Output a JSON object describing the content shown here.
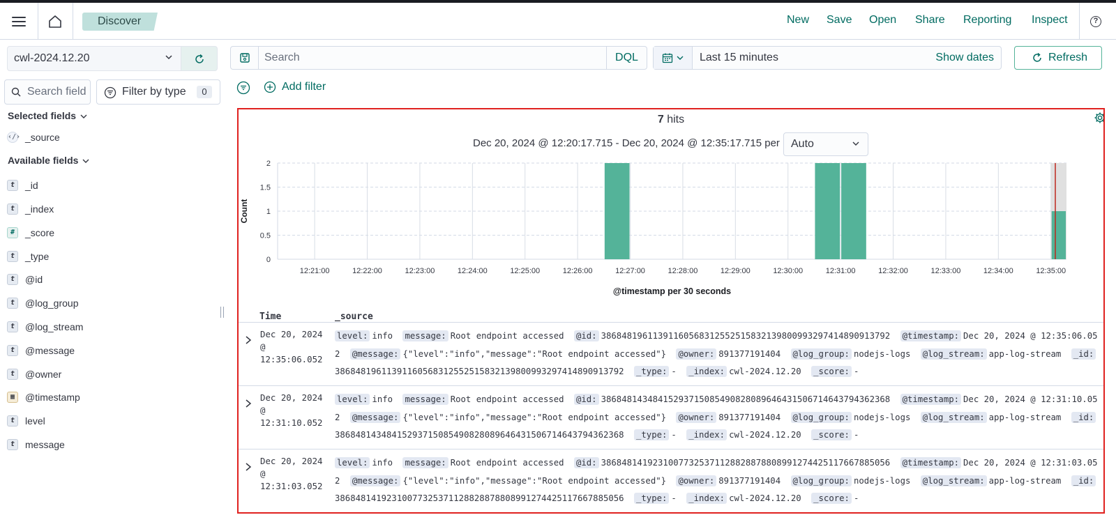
{
  "header": {
    "breadcrumb": "Discover",
    "menu": [
      "New",
      "Save",
      "Open",
      "Share",
      "Reporting",
      "Inspect"
    ]
  },
  "sidebar": {
    "index_pattern": "cwl-2024.12.20",
    "search_placeholder": "Search field names",
    "filter_by_type_label": "Filter by type",
    "filter_count": "0",
    "selected_title": "Selected fields",
    "selected_fields": [
      {
        "name": "_source",
        "type": "source"
      }
    ],
    "available_title": "Available fields",
    "available_fields": [
      {
        "name": "_id",
        "type": "t"
      },
      {
        "name": "_index",
        "type": "t"
      },
      {
        "name": "_score",
        "type": "#"
      },
      {
        "name": "_type",
        "type": "t"
      },
      {
        "name": "@id",
        "type": "t"
      },
      {
        "name": "@log_group",
        "type": "t"
      },
      {
        "name": "@log_stream",
        "type": "t"
      },
      {
        "name": "@message",
        "type": "t"
      },
      {
        "name": "@owner",
        "type": "t"
      },
      {
        "name": "@timestamp",
        "type": "date"
      },
      {
        "name": "level",
        "type": "t"
      },
      {
        "name": "message",
        "type": "t"
      }
    ]
  },
  "query": {
    "placeholder": "Search",
    "language": "DQL",
    "time_range": "Last 15 minutes",
    "show_dates": "Show dates",
    "refresh": "Refresh",
    "add_filter": "Add filter"
  },
  "results": {
    "hits_count": "7",
    "hits_label": "hits",
    "range_text": "Dec 20, 2024 @ 12:20:17.715 - Dec 20, 2024 @ 12:35:17.715 per",
    "interval": "Auto",
    "columns": [
      "Time",
      "_source"
    ],
    "rows": [
      {
        "time": [
          "Dec 20, 2024",
          "@",
          "12:35:06.052"
        ],
        "fields": [
          {
            "k": "level:",
            "v": "info"
          },
          {
            "k": "message:",
            "v": "Root endpoint accessed"
          },
          {
            "k": "@id:",
            "v": "38684819611391160568312552515832139800993297414890913792"
          },
          {
            "k": "@timestamp:",
            "v": "Dec 20, 2024 @ 12:35:06.052"
          },
          {
            "k": "@message:",
            "v": "{\"level\":\"info\",\"message\":\"Root endpoint accessed\"}"
          },
          {
            "k": "@owner:",
            "v": "891377191404"
          },
          {
            "k": "@log_group:",
            "v": "nodejs-logs"
          },
          {
            "k": "@log_stream:",
            "v": "app-log-stream"
          },
          {
            "k": "_id:",
            "v": "38684819611391160568312552515832139800993297414890913792"
          },
          {
            "k": "_type:",
            "v": "-"
          },
          {
            "k": "_index:",
            "v": "cwl-2024.12.20"
          },
          {
            "k": "_score:",
            "v": "-"
          }
        ]
      },
      {
        "time": [
          "Dec 20, 2024",
          "@",
          "12:31:10.052"
        ],
        "fields": [
          {
            "k": "level:",
            "v": "info"
          },
          {
            "k": "message:",
            "v": "Root endpoint accessed"
          },
          {
            "k": "@id:",
            "v": "38684814348415293715085490828089646431506714643794362368"
          },
          {
            "k": "@timestamp:",
            "v": "Dec 20, 2024 @ 12:31:10.052"
          },
          {
            "k": "@message:",
            "v": "{\"level\":\"info\",\"message\":\"Root endpoint accessed\"}"
          },
          {
            "k": "@owner:",
            "v": "891377191404"
          },
          {
            "k": "@log_group:",
            "v": "nodejs-logs"
          },
          {
            "k": "@log_stream:",
            "v": "app-log-stream"
          },
          {
            "k": "_id:",
            "v": "38684814348415293715085490828089646431506714643794362368"
          },
          {
            "k": "_type:",
            "v": "-"
          },
          {
            "k": "_index:",
            "v": "cwl-2024.12.20"
          },
          {
            "k": "_score:",
            "v": "-"
          }
        ]
      },
      {
        "time": [
          "Dec 20, 2024",
          "@",
          "12:31:03.052"
        ],
        "fields": [
          {
            "k": "level:",
            "v": "info"
          },
          {
            "k": "message:",
            "v": "Root endpoint accessed"
          },
          {
            "k": "@id:",
            "v": "38684814192310077325371128828878808991274425117667885056"
          },
          {
            "k": "@timestamp:",
            "v": "Dec 20, 2024 @ 12:31:03.052"
          },
          {
            "k": "@message:",
            "v": "{\"level\":\"info\",\"message\":\"Root endpoint accessed\"}"
          },
          {
            "k": "@owner:",
            "v": "891377191404"
          },
          {
            "k": "@log_group:",
            "v": "nodejs-logs"
          },
          {
            "k": "@log_stream:",
            "v": "app-log-stream"
          },
          {
            "k": "_id:",
            "v": "38684814192310077325371128828878808991274425117667885056"
          },
          {
            "k": "_type:",
            "v": "-"
          },
          {
            "k": "_index:",
            "v": "cwl-2024.12.20"
          },
          {
            "k": "_score:",
            "v": "-"
          }
        ]
      }
    ]
  },
  "chart_data": {
    "type": "bar",
    "xlabel": "@timestamp per 30 seconds",
    "ylabel": "Count",
    "ylim": [
      0,
      2
    ],
    "yticks": [
      "0",
      "0.5",
      "1",
      "1.5",
      "2"
    ],
    "x_ticks": [
      "12:21:00",
      "12:22:00",
      "12:23:00",
      "12:24:00",
      "12:25:00",
      "12:26:00",
      "12:27:00",
      "12:28:00",
      "12:29:00",
      "12:30:00",
      "12:31:00",
      "12:32:00",
      "12:33:00",
      "12:34:00",
      "12:35:00"
    ],
    "bins": [
      {
        "start": "12:26:30",
        "count": 2
      },
      {
        "start": "12:30:30",
        "count": 2
      },
      {
        "start": "12:31:00",
        "count": 2
      },
      {
        "start": "12:35:00",
        "count": 1
      }
    ],
    "range_start": "12:20:17.715",
    "range_end": "12:35:17.715",
    "colors": {
      "bar": "#54b399",
      "now_marker": "#bd271e",
      "partial_bucket": "#e0e0e0"
    }
  }
}
